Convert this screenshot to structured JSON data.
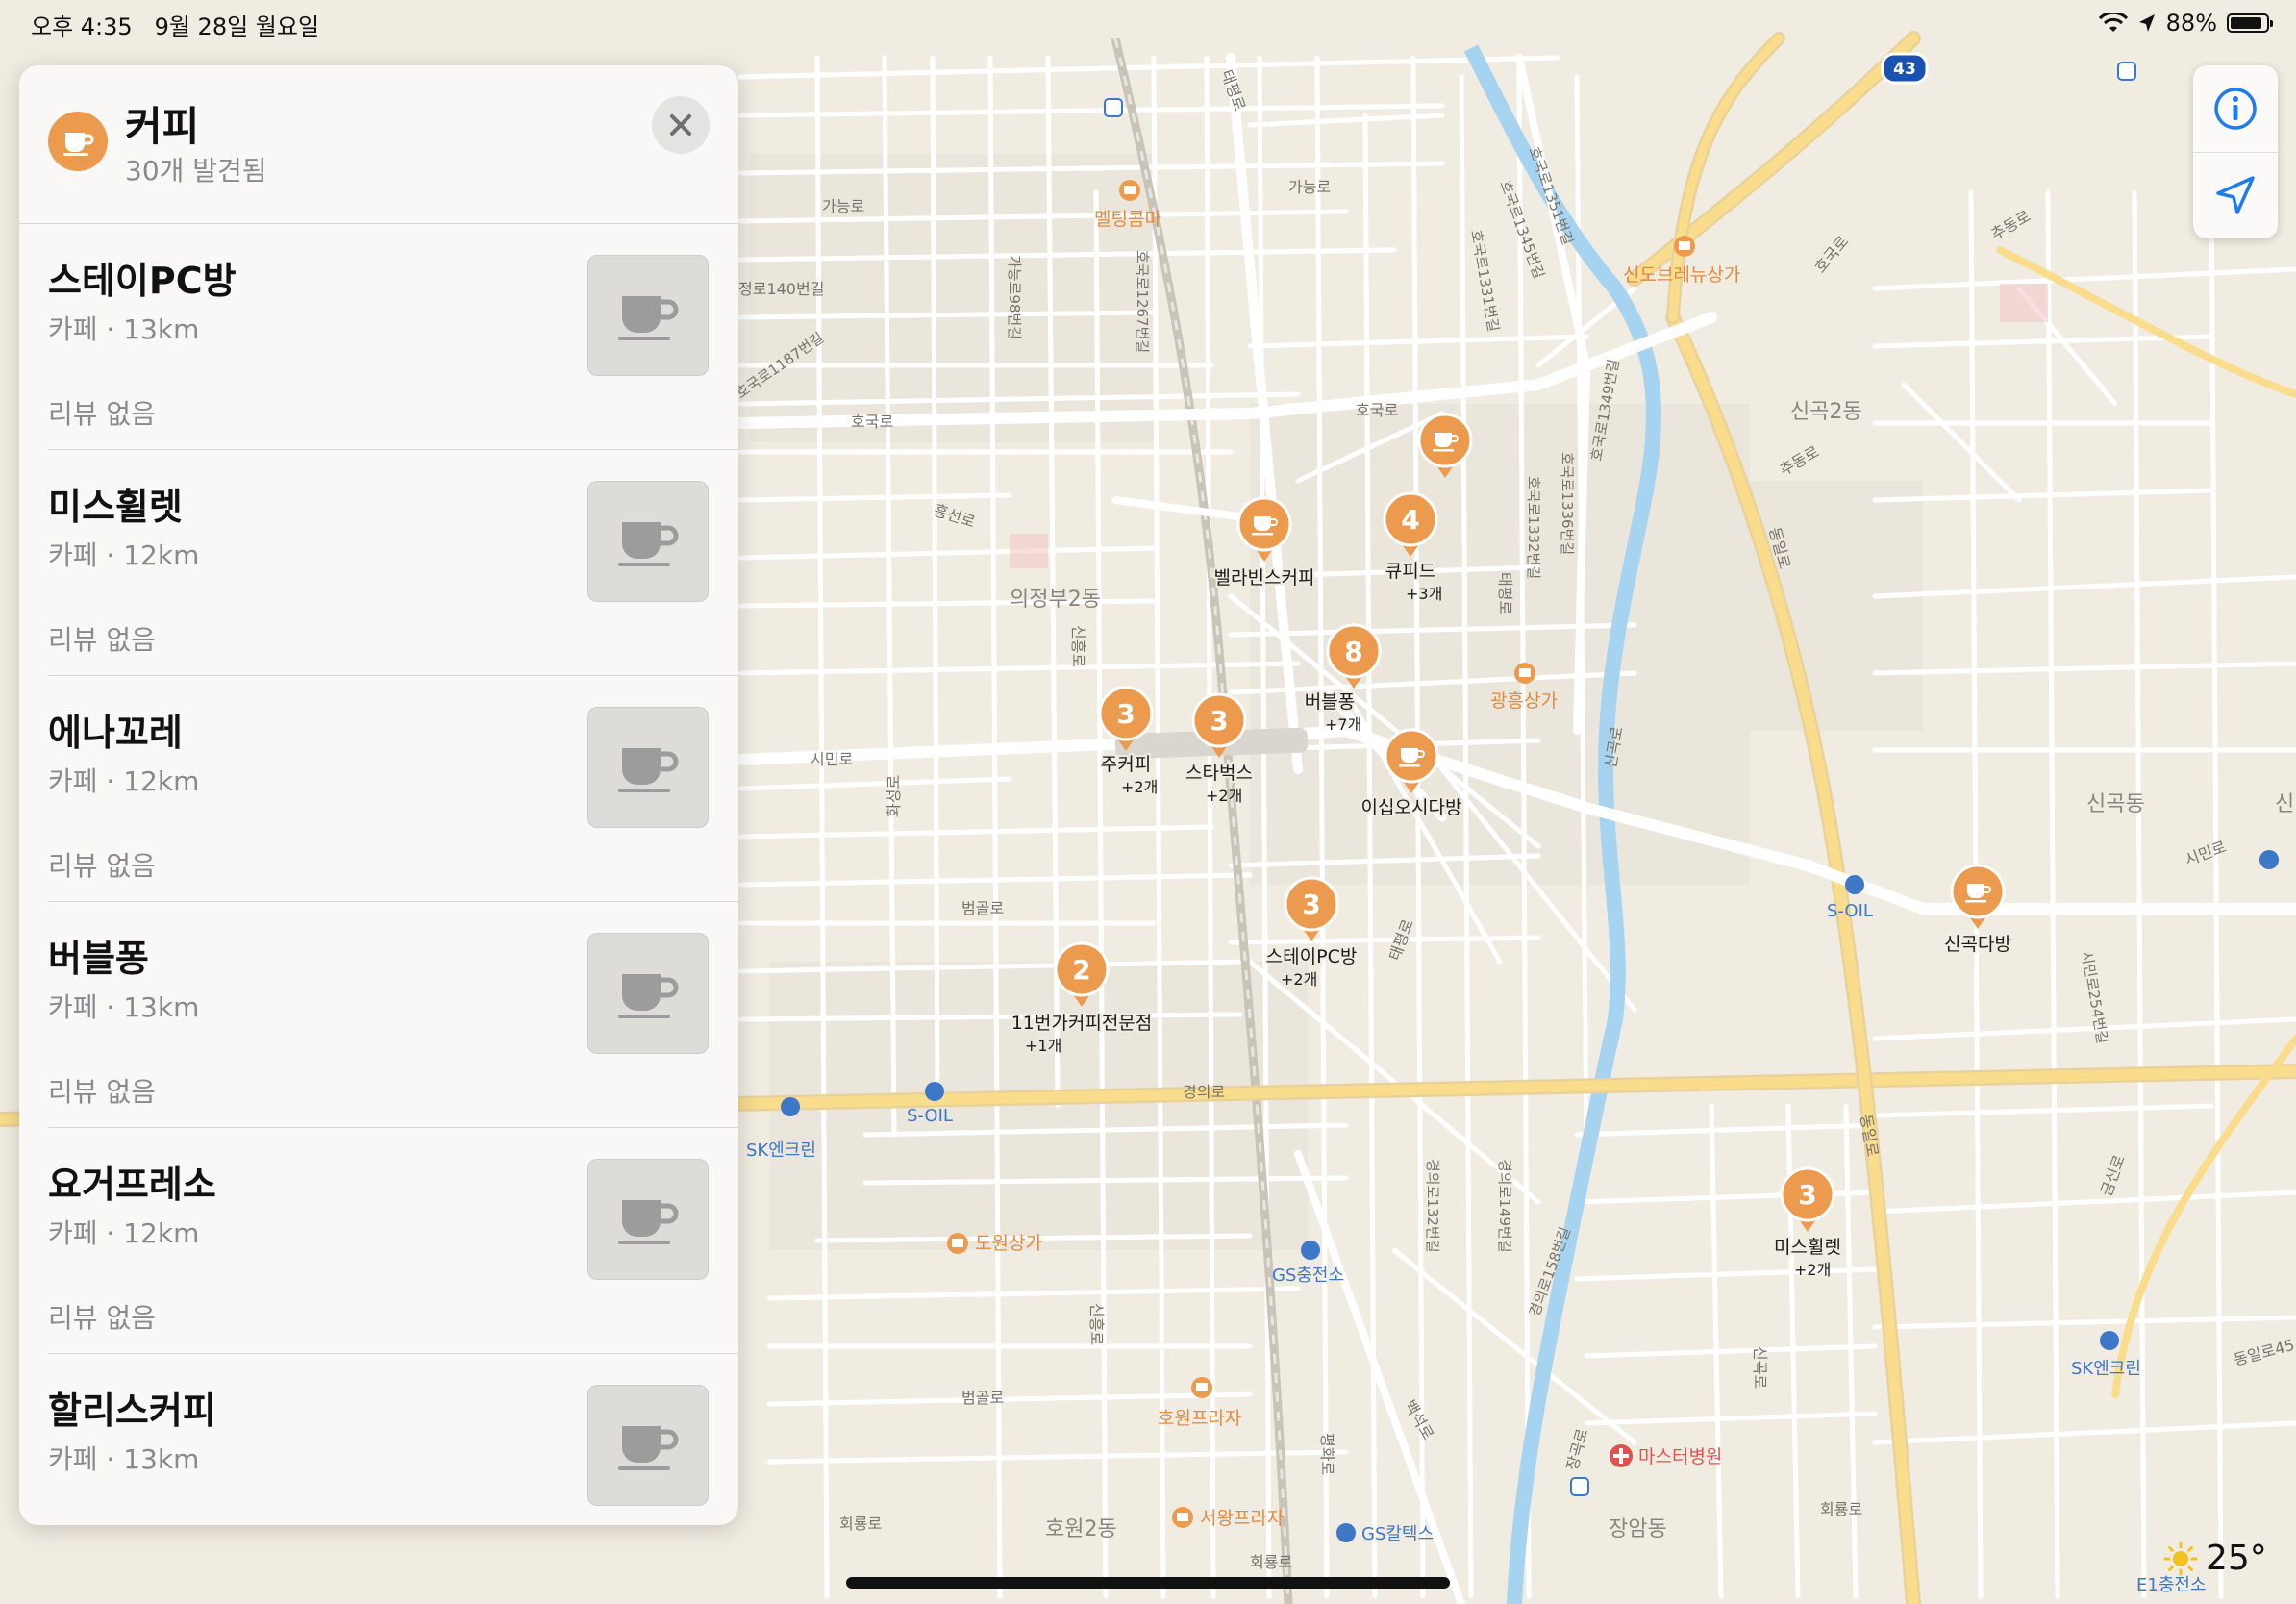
{
  "status": {
    "time": "오후 4:35",
    "date": "9월 28일 월요일",
    "battery_text": "88%",
    "battery_level": 0.88
  },
  "panel": {
    "title": "커피",
    "subtitle": "30개 발견됨",
    "category_icon": "coffee-cup-icon",
    "close_icon": "close-icon",
    "results": [
      {
        "name": "스테이PC방",
        "meta": "카페 · 13km",
        "review": "리뷰 없음"
      },
      {
        "name": "미스휠렛",
        "meta": "카페 · 12km",
        "review": "리뷰 없음"
      },
      {
        "name": "에나꼬레",
        "meta": "카페 · 12km",
        "review": "리뷰 없음"
      },
      {
        "name": "버블퐁",
        "meta": "카페 · 13km",
        "review": "리뷰 없음"
      },
      {
        "name": "요거프레소",
        "meta": "카페 · 12km",
        "review": "리뷰 없음"
      },
      {
        "name": "할리스커피",
        "meta": "카페 · 13km",
        "review": "리뷰 없음"
      }
    ]
  },
  "map": {
    "pins": [
      {
        "id": "pin-cafe-top",
        "count": "",
        "label": "",
        "more": ""
      },
      {
        "id": "pin-bellabins",
        "count": "",
        "label": "벨라빈스커피",
        "more": ""
      },
      {
        "id": "pin-cupid",
        "count": "4",
        "label": "큐피드",
        "more": "+3개"
      },
      {
        "id": "pin-bubblepong",
        "count": "8",
        "label": "버블퐁",
        "more": "+7개"
      },
      {
        "id": "pin-jucoffee",
        "count": "3",
        "label": "주커피",
        "more": "+2개"
      },
      {
        "id": "pin-starbucks",
        "count": "3",
        "label": "스타벅스",
        "more": "+2개"
      },
      {
        "id": "pin-isibosi",
        "count": "",
        "label": "이십오시다방",
        "more": ""
      },
      {
        "id": "pin-staypc",
        "count": "3",
        "label": "스테이PC방",
        "more": "+2개"
      },
      {
        "id": "pin-11st",
        "count": "2",
        "label": "11번가커피전문점",
        "more": "+1개"
      },
      {
        "id": "pin-singok",
        "count": "",
        "label": "신곡다방",
        "more": ""
      },
      {
        "id": "pin-mishwillet",
        "count": "3",
        "label": "미스휠렛",
        "more": "+2개"
      }
    ],
    "places": {
      "melting": "멜팅콤마",
      "sindo": "신도브레뉴상가",
      "gwangheung": "광흥상가",
      "dowon": "도원상가",
      "howon_plaza": "호원프라자",
      "seowang_plaza": "서왕프라자",
      "master": "마스터병원",
      "gs_station": "GS충전소",
      "gs_caltex": "GS칼텍스",
      "soil_1": "S-OIL",
      "soil_2": "S-OIL",
      "sk_1": "SK엔크린",
      "sk_2": "SK엔크린",
      "e1": "E1충전소"
    },
    "roads": {
      "hoguk": "호국로",
      "hoguk2": "호국로",
      "hoguk_1267": "호국로1267번길",
      "hoguk_1351": "호국로1351번길",
      "hoguk_1345": "호국로1345번길",
      "hoguk_1331": "호국로1331번길",
      "hoguk_1336": "호국로1336번길",
      "hoguk_1332": "호국로1332번길",
      "hoguk_1349": "호국로1349번길",
      "hoguk_1187": "호국로1187번길",
      "gano": "가능로",
      "gano2": "가능로",
      "gano_98": "가능로98번길",
      "jeong_140": "정로140번길",
      "hongseon": "흥선로",
      "simin": "시민로",
      "simin2": "시민로",
      "beomgol": "범골로",
      "beomgol2": "범골로",
      "gyeongui": "경의로",
      "gyeongui_132": "경의로132번길",
      "gyeongui_149": "경의로149번길",
      "gyeongui_158": "경의로158번길",
      "dongil": "동일로",
      "dongil2": "동일로",
      "dongil3": "동일로45",
      "taepyeong": "태평로",
      "taepyeong2": "태평로",
      "taepyeong3": "태평로",
      "singok_ro": "신곡로",
      "singok_ro2": "신곡로",
      "jangam_ro": "장곡로",
      "chudong": "추동로",
      "chudong2": "추동로",
      "geumsin": "금신로",
      "hoewon": "회룡로",
      "hoewon2": "회룡로",
      "hoewon3": "회룡로",
      "baekseok": "백석로",
      "pyeonghwa": "평화로",
      "simin_254": "시민로254번길",
      "sinheung": "신흥로",
      "sinheung2": "신흥로",
      "hwaseong": "화성로",
      "hoguk_top": "호국로"
    },
    "areas": {
      "uijeongbu2": "의정부2동",
      "singok2": "신곡2동",
      "singok": "신곡동",
      "singok_edge": "신",
      "howon2": "호원2동",
      "jangam": "장암동"
    },
    "highway_shield": "43"
  },
  "controls": {
    "info_icon": "info-icon",
    "location_icon": "location-arrow-icon"
  },
  "weather": {
    "icon": "sun-icon",
    "temp": "25°"
  },
  "colors": {
    "accent": "#ec9a4e",
    "map_bg": "#f1ece2",
    "river": "#a6d3ef",
    "major_road": "#f9dd8d",
    "control_blue": "#1d7df0"
  }
}
